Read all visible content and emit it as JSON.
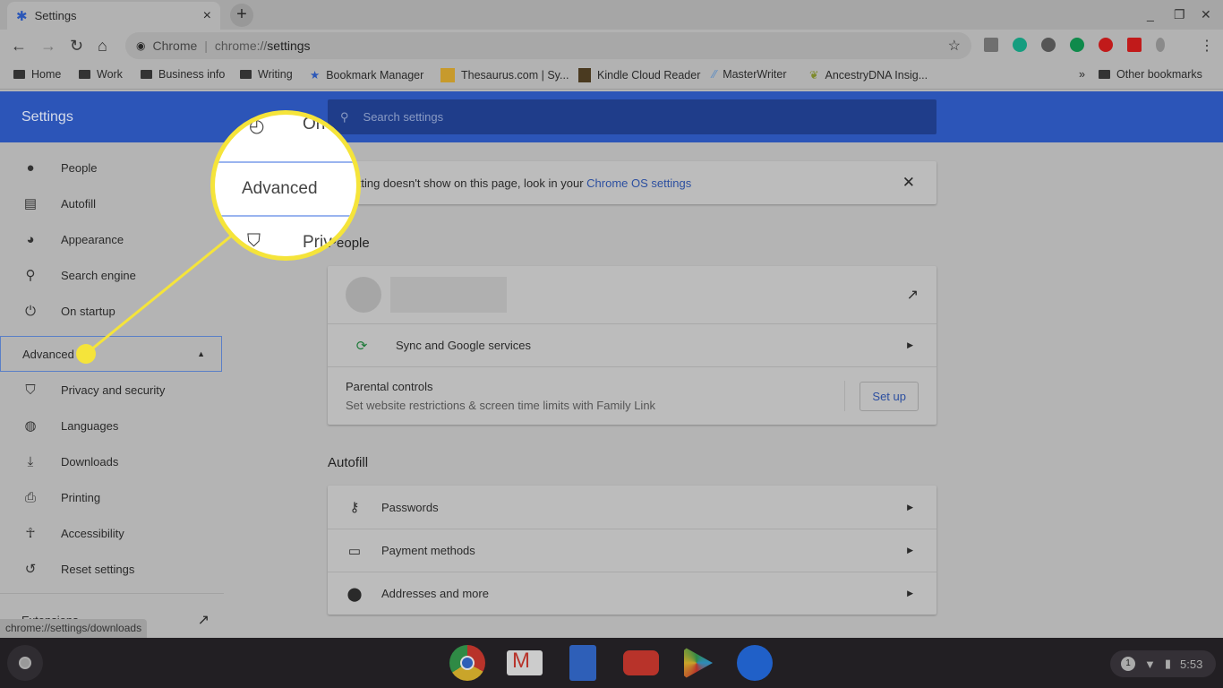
{
  "tab": {
    "title": "Settings",
    "close": "×",
    "new_tab": "+"
  },
  "window": {
    "minimize": "_",
    "restore": "❐",
    "close": "✕"
  },
  "toolbar": {
    "chip": "Chrome",
    "url_prefix": "chrome://",
    "url_path": "settings",
    "star": "☆",
    "menu": "⋮"
  },
  "extensions": [
    {
      "name": "z",
      "color": "#6f6f6f"
    },
    {
      "name": "grammarly",
      "color": "#159d7f"
    },
    {
      "name": "pinterest",
      "color": "#555555"
    },
    {
      "name": "hangouts",
      "color": "#0f8a4b"
    },
    {
      "name": "adblock",
      "color": "#c11a1a"
    },
    {
      "name": "pause",
      "color": "#c11a1a"
    },
    {
      "name": "bluetooth-ish",
      "color": "#8a8a8a"
    }
  ],
  "bookmarks": [
    {
      "label": "Home",
      "icon": "folder"
    },
    {
      "label": "Work",
      "icon": "folder"
    },
    {
      "label": "Business info",
      "icon": "folder"
    },
    {
      "label": "Writing",
      "icon": "folder"
    },
    {
      "label": "Bookmark Manager",
      "icon": "star"
    },
    {
      "label": "Thesaurus.com | Sy...",
      "icon": "thesaurus"
    },
    {
      "label": "Kindle Cloud Reader",
      "icon": "kindle"
    },
    {
      "label": "MasterWriter",
      "icon": "masterwriter"
    },
    {
      "label": "AncestryDNA Insig...",
      "icon": "ancestry"
    }
  ],
  "bookmarks_overflow": "»",
  "other_bookmarks": "Other bookmarks",
  "header": {
    "title": "Settings",
    "search_placeholder": "Search settings"
  },
  "sidebar": {
    "items": [
      {
        "label": "People",
        "icon": "person"
      },
      {
        "label": "Autofill",
        "icon": "clipboard"
      },
      {
        "label": "Appearance",
        "icon": "palette"
      },
      {
        "label": "Search engine",
        "icon": "search"
      },
      {
        "label": "On startup",
        "icon": "power"
      }
    ],
    "advanced": "Advanced",
    "advanced_items": [
      {
        "label": "Privacy and security",
        "icon": "shield"
      },
      {
        "label": "Languages",
        "icon": "globe"
      },
      {
        "label": "Downloads",
        "icon": "download"
      },
      {
        "label": "Printing",
        "icon": "printer"
      },
      {
        "label": "Accessibility",
        "icon": "accessibility"
      },
      {
        "label": "Reset settings",
        "icon": "history"
      }
    ],
    "extensions": "Extensions"
  },
  "notice": {
    "text": "setting doesn't show on this page, look in your ",
    "link": "Chrome OS settings"
  },
  "people": {
    "heading": "People",
    "sync": "Sync and Google services",
    "parental_title": "Parental controls",
    "parental_sub": "Set website restrictions & screen time limits with Family Link",
    "setup": "Set up"
  },
  "autofill": {
    "heading": "Autofill",
    "items": [
      "Passwords",
      "Payment methods",
      "Addresses and more"
    ]
  },
  "status_url": "chrome://settings/downloads",
  "magnifier": {
    "above": "On",
    "label": "Advanced",
    "below": "Priv"
  },
  "tray": {
    "notifications": "1",
    "time": "5:53"
  },
  "colors": {
    "highlight": "#f5e43a",
    "header": "#2c55b8"
  }
}
